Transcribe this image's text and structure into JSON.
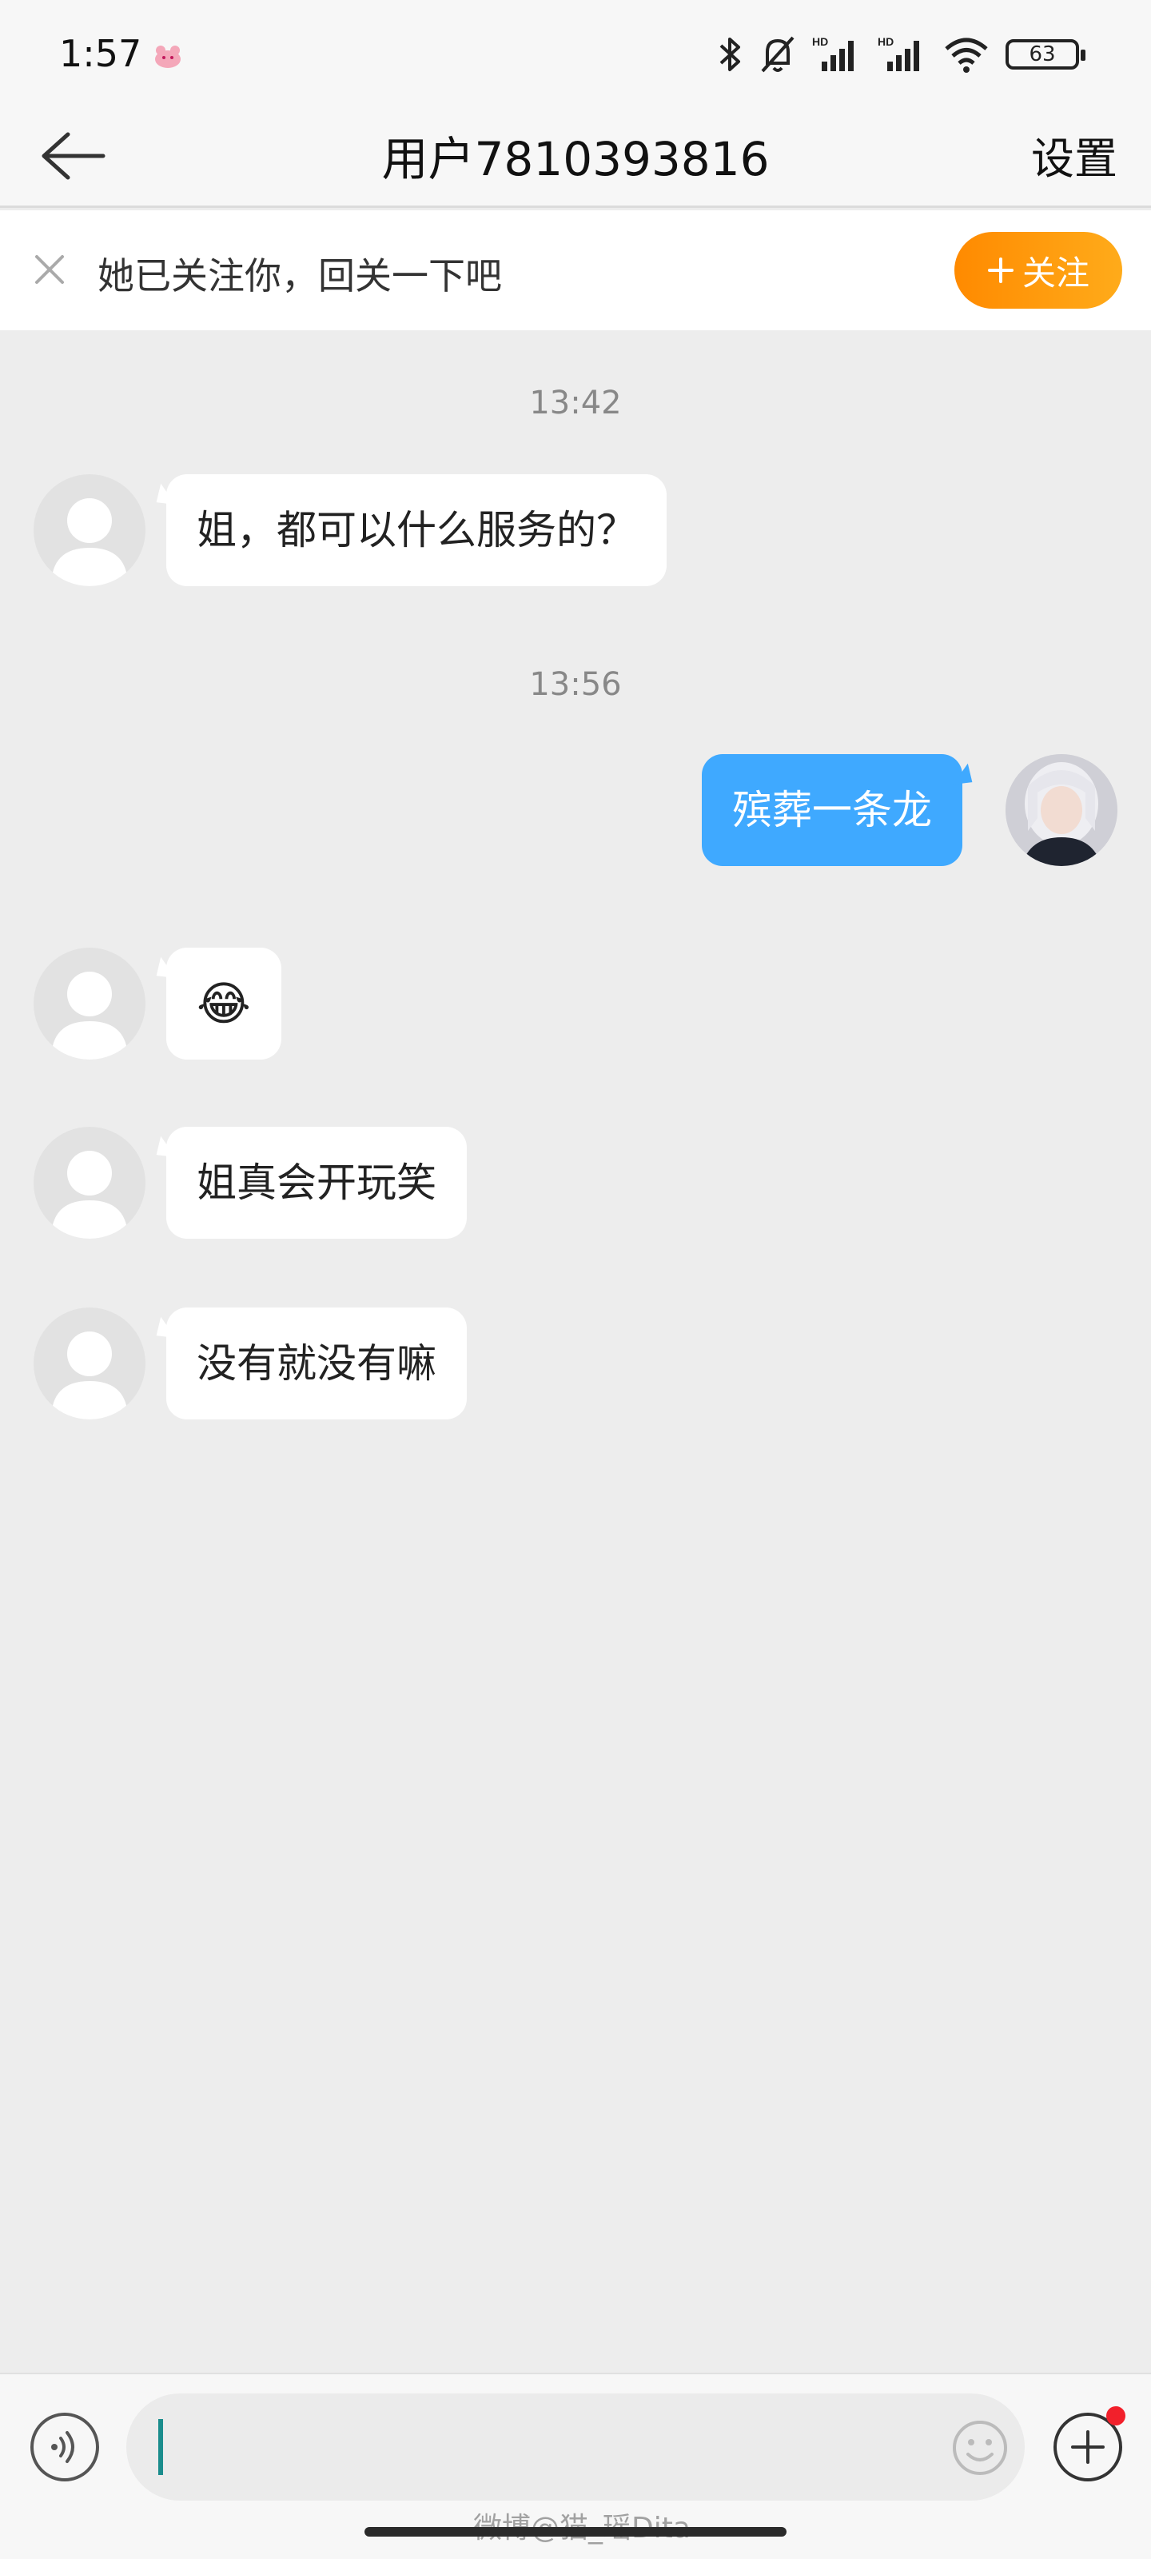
{
  "status_bar": {
    "time": "1:57",
    "battery": "63"
  },
  "nav": {
    "title": "用户7810393816",
    "settings_label": "设置"
  },
  "follow_banner": {
    "text": "她已关注你，回关一下吧",
    "follow_label": "关注"
  },
  "messages": {
    "timestamp_1": "13:42",
    "msg_1": "姐，都可以什么服务的？",
    "timestamp_2": "13:56",
    "msg_2": "殡葬一条龙",
    "msg_3": "😂",
    "msg_4": "姐真会开玩笑",
    "msg_5": "没有就没有嘛"
  },
  "input": {
    "value": "",
    "placeholder": ""
  },
  "watermark": "微博@猫_瑶Dita",
  "colors": {
    "accent_blue": "#3fa9ff",
    "follow_orange": "#ff8a00",
    "notification_red": "#f2202b"
  }
}
